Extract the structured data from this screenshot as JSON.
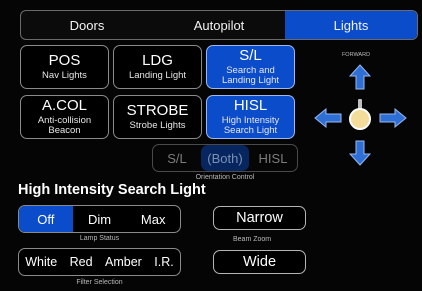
{
  "tabs": [
    {
      "label": "Doors",
      "active": false
    },
    {
      "label": "Autopilot",
      "active": false
    },
    {
      "label": "Lights",
      "active": true
    }
  ],
  "lights": [
    {
      "id": "pos",
      "title": "POS",
      "sub": "Nav Lights",
      "active": false
    },
    {
      "id": "ldg",
      "title": "LDG",
      "sub": "Landing Light",
      "active": false
    },
    {
      "id": "sl",
      "title": "S/L",
      "sub": "Search and Landing Light",
      "active": true
    },
    {
      "id": "acol",
      "title": "A.COL",
      "sub": "Anti-collision Beacon",
      "active": false
    },
    {
      "id": "strobe",
      "title": "STROBE",
      "sub": "Strobe Lights",
      "active": false
    },
    {
      "id": "hisl",
      "title": "HISL",
      "sub": "High Intensity Search Light",
      "active": true
    }
  ],
  "orientation": {
    "options": [
      "S/L",
      "(Both)",
      "HISL"
    ],
    "selected": "(Both)",
    "caption": "Orientation Control"
  },
  "section_title": "High Intensity Search Light",
  "lamp_status": {
    "options": [
      "Off",
      "Dim",
      "Max"
    ],
    "selected": "Off",
    "caption": "Lamp Status"
  },
  "beam_zoom": {
    "options": [
      "Narrow",
      "Wide"
    ],
    "caption": "Beam Zoom"
  },
  "filter": {
    "options": [
      "White",
      "Red",
      "Amber",
      "I.R."
    ],
    "caption": "Filter Selection"
  },
  "direction_pad": {
    "forward_label": "FORWARD",
    "arrow_icons": [
      "arrow-up-icon",
      "arrow-left-icon",
      "arrow-right-icon",
      "arrow-down-icon"
    ],
    "arrow_color": "#2e6fd6",
    "knob_color": "#f4dc9a"
  },
  "colors": {
    "accent": "#0a4cc9",
    "background": "#050505"
  }
}
